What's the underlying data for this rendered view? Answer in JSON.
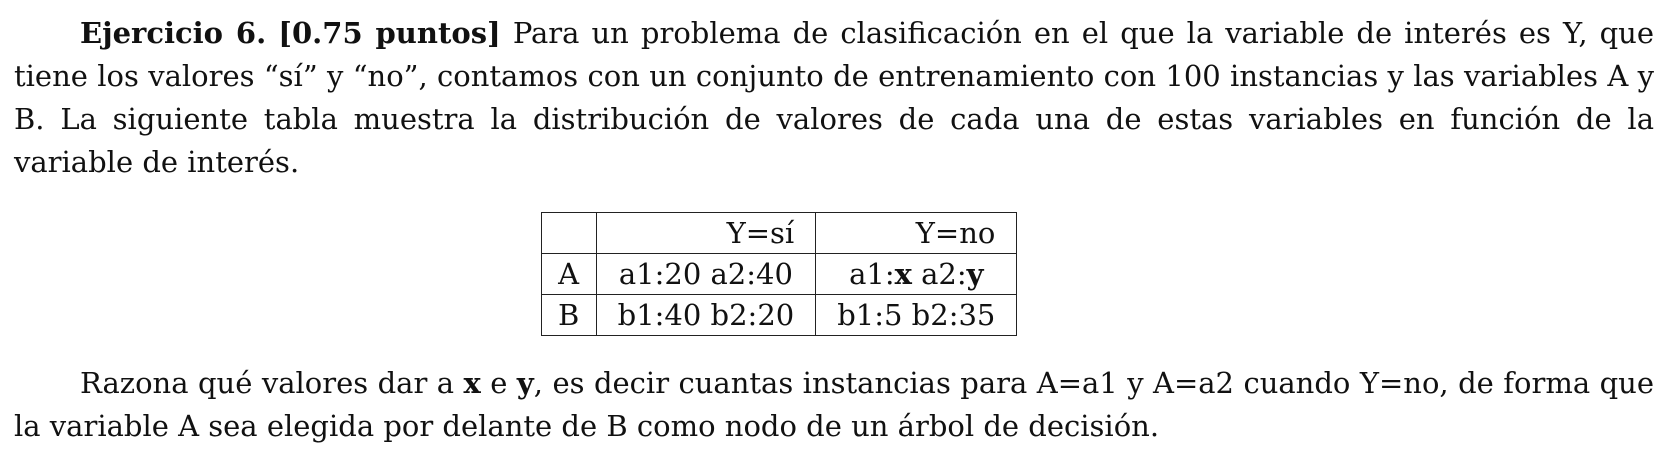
{
  "exercise": {
    "heading": "Ejercicio 6.",
    "points": "[0.75 puntos]",
    "intro_text": "Para un problema de clasificación en el que la variable de interés es Y, que tiene los valores “sí” y “no”, contamos con un conjunto de entrenamiento con 100 instancias y las variables A y B. La siguiente tabla muestra la distribución de valores de cada una de estas variables en función de la variable de interés."
  },
  "table": {
    "col_headers": [
      "",
      "Y=sí",
      "Y=no"
    ],
    "rows": [
      {
        "label": "A",
        "yes": {
          "text": "a1:20 a2:40"
        },
        "no": {
          "p1": "a1:",
          "v1": "x",
          "p2": " a2:",
          "v2": "y"
        }
      },
      {
        "label": "B",
        "yes": {
          "text": "b1:40 b2:20"
        },
        "no": {
          "text": "b1:5 b2:35"
        }
      }
    ]
  },
  "question": {
    "t1": "Razona qué valores dar a ",
    "x": "x",
    "t2": " e ",
    "y": "y",
    "t3": ", es decir cuantas instancias para A=a1 y A=a2 cuando Y=no, de forma que la variable A sea elegida por delante de B como nodo de un árbol de decisión."
  }
}
